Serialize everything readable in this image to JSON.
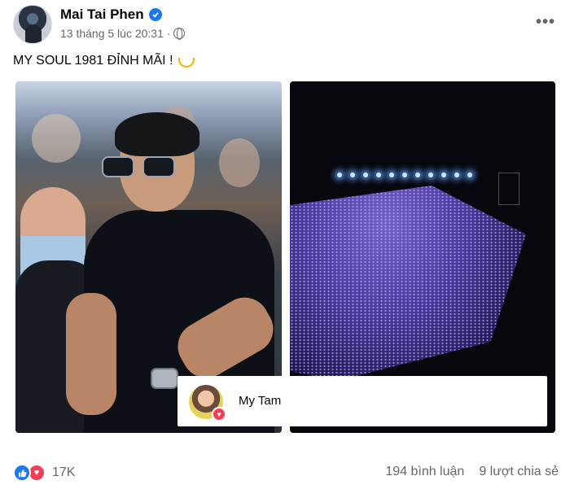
{
  "post": {
    "author": "Mai Tai Phen",
    "timestamp": "13 tháng 5 lúc 20:31 ·",
    "privacy_icon": "globe-icon",
    "more_glyph": "•••",
    "caption": "MY SOUL 1981 ĐỈNH MÃI !"
  },
  "tag_overlay": {
    "name": "My Tam",
    "reaction_icon": "heart-icon"
  },
  "footer": {
    "reaction_count": "17K",
    "comments": "194 bình luận",
    "shares": "9 lượt chia sẻ"
  },
  "colors": {
    "verified_blue": "#1877f2",
    "love_red": "#f33e58",
    "meta_gray": "#65676b"
  }
}
